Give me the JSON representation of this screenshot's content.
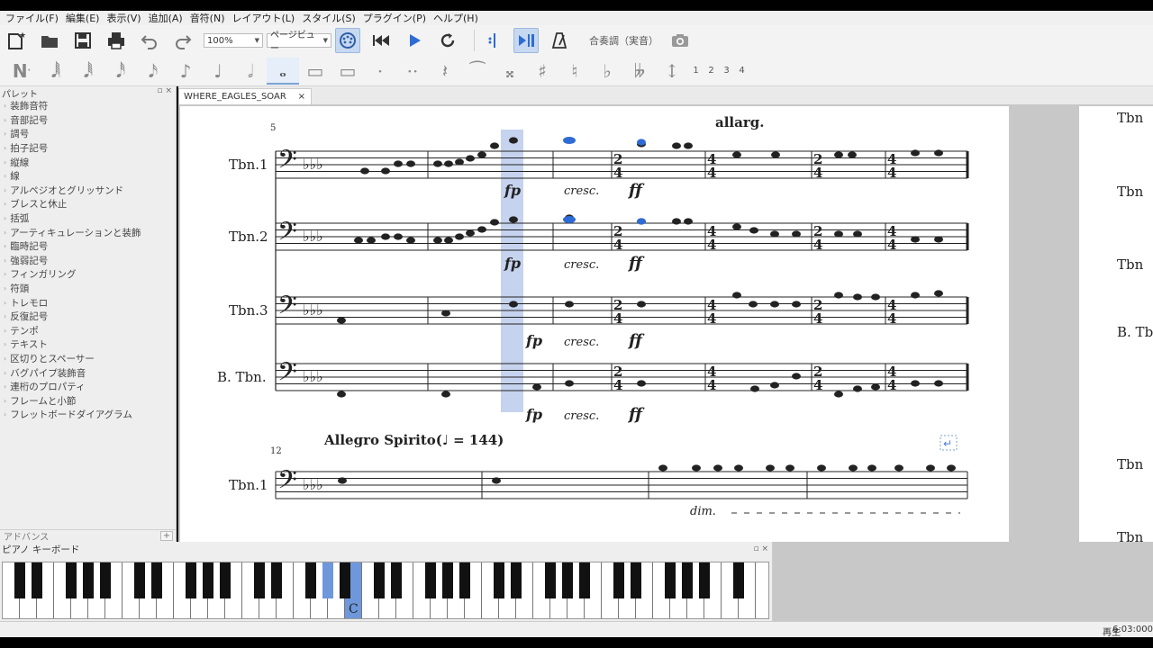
{
  "menubar": [
    "ファイル(F)",
    "編集(E)",
    "表示(V)",
    "追加(A)",
    "音符(N)",
    "レイアウト(L)",
    "スタイル(S)",
    "プラグイン(P)",
    "ヘルプ(H)"
  ],
  "toolbar": {
    "zoom": "100%",
    "view_mode": "ページビュー",
    "concert_pitch": "合奏調（実音）"
  },
  "note_input": {
    "voices": [
      "1",
      "2",
      "3",
      "4"
    ]
  },
  "palette": {
    "title": "パレット",
    "items": [
      "装飾音符",
      "音部記号",
      "調号",
      "拍子記号",
      "縦線",
      "線",
      "アルペジオとグリッサンド",
      "ブレスと休止",
      "括弧",
      "アーティキュレーションと装飾",
      "臨時記号",
      "強弱記号",
      "フィンガリング",
      "符頭",
      "トレモロ",
      "反復記号",
      "テンポ",
      "テキスト",
      "区切りとスペーサー",
      "バグパイプ装飾音",
      "連桁のプロパティ",
      "フレームと小節",
      "フレットボードダイアグラム"
    ],
    "footer": "アドバンス"
  },
  "score": {
    "tab": "WHERE_EAGLES_SOAR",
    "measure_num_1": "5",
    "measure_num_2": "12",
    "instruments": [
      "Tbn.1",
      "Tbn.2",
      "Tbn.3",
      "B. Tbn."
    ],
    "system2_instrument": "Tbn.1",
    "tempo_text": "allarg.",
    "tempo_mark": "Allegro Spirito(♩ = 144)",
    "dyn_fp": "fp",
    "dyn_ff": "ff",
    "cresc": "cresc.",
    "dim": "dim.",
    "page2_names": [
      "Tbn",
      "Tbn",
      "Tbn",
      "B. Tb",
      "Tbn",
      "Tbn"
    ]
  },
  "piano": {
    "title": "ピアノ キーボード",
    "c_label": "C"
  },
  "status": {
    "state": "再生",
    "time": "6:03:000"
  },
  "colors": {
    "selection": "#c5d3ef",
    "selected_note": "#2f6bd4",
    "key_highlight": "#6f98dc"
  }
}
